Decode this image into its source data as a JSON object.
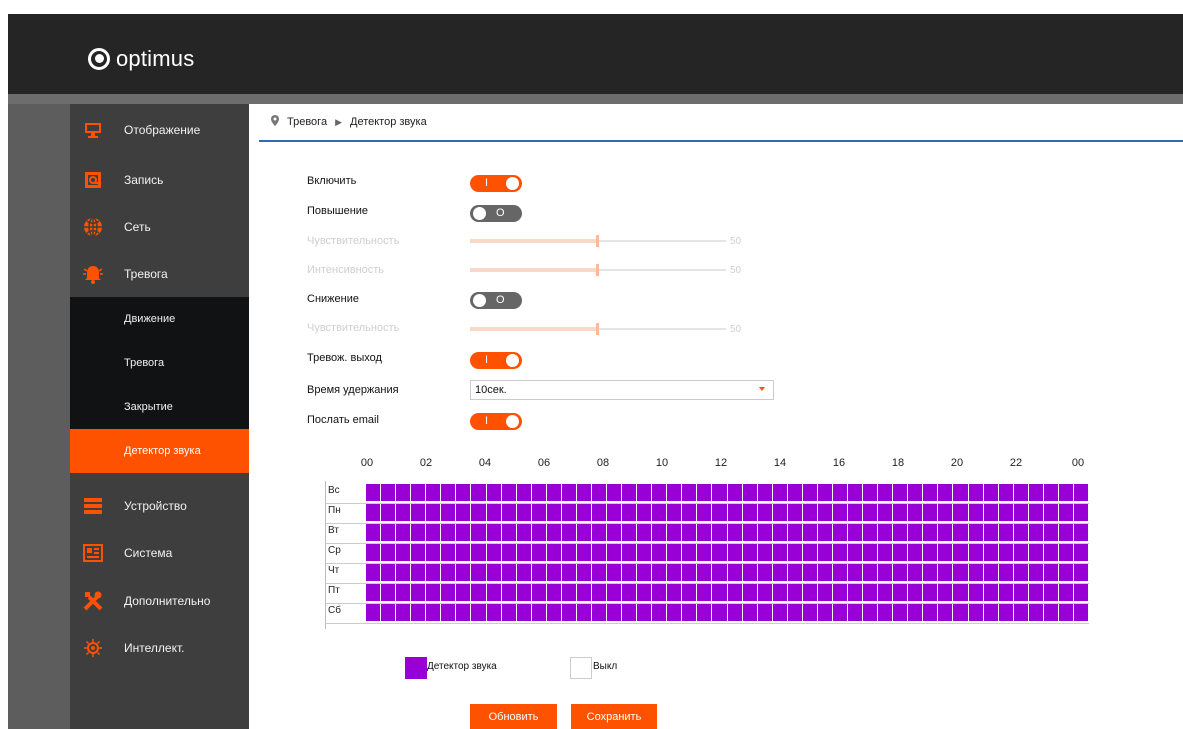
{
  "app": {
    "brand": "optimus"
  },
  "sidebar": {
    "items": [
      {
        "label": "Отображение",
        "icon": "monitor-icon"
      },
      {
        "label": "Запись",
        "icon": "record-icon"
      },
      {
        "label": "Сеть",
        "icon": "network-globe-icon"
      },
      {
        "label": "Тревога",
        "icon": "alarm-bell-icon"
      },
      {
        "label": "Устройство",
        "icon": "storage-device-icon"
      },
      {
        "label": "Система",
        "icon": "system-icon"
      },
      {
        "label": "Дополнительно",
        "icon": "tools-icon"
      },
      {
        "label": "Интеллект.",
        "icon": "intelligence-icon"
      }
    ],
    "sub_items": [
      {
        "label": "Движение"
      },
      {
        "label": "Тревога"
      },
      {
        "label": "Закрытие"
      },
      {
        "label": "Детектор звука",
        "active": true
      }
    ]
  },
  "breadcrumb": {
    "root": "Тревога",
    "current": "Детектор звука"
  },
  "form": {
    "enable": {
      "label": "Включить",
      "state": "I"
    },
    "increase": {
      "label": "Повышение",
      "state": "O"
    },
    "sensitivity_1": {
      "label": "Чувствительность",
      "value": "50",
      "level": 0.5
    },
    "intensity": {
      "label": "Интенсивность",
      "value": "50",
      "level": 0.5
    },
    "decrease": {
      "label": "Снижение",
      "state": "O"
    },
    "sensitivity_2": {
      "label": "Чувствительность",
      "value": "50",
      "level": 0.5
    },
    "alarm_output": {
      "label": "Тревож. выход",
      "state": "I"
    },
    "delay": {
      "label": "Время удержания",
      "value": "10сек."
    },
    "send_email": {
      "label": "Послать email",
      "state": "I"
    }
  },
  "schedule": {
    "hours": [
      "00",
      "02",
      "04",
      "06",
      "08",
      "10",
      "12",
      "14",
      "16",
      "18",
      "20",
      "22",
      "00"
    ],
    "days": [
      "Вс",
      "Пн",
      "Вт",
      "Ср",
      "Чт",
      "Пт",
      "Сб"
    ],
    "slots_per_day": 48,
    "all_active": true,
    "active_color": "#9900d6"
  },
  "legend": {
    "detector": {
      "label": "Детектор звука",
      "color": "#9900d6"
    },
    "none": {
      "label": "Выкл",
      "color": "#ffffff"
    }
  },
  "buttons": {
    "refresh": "Обновить",
    "save": "Сохранить"
  },
  "colors": {
    "accent": "#ff5200",
    "topbar": "#252525",
    "sidebar": "#3e3e3e"
  }
}
